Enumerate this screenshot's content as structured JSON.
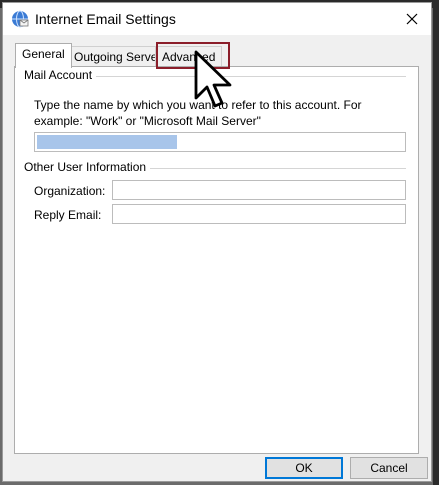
{
  "window": {
    "title": "Internet Email Settings",
    "title_icon": "globe-mail-icon",
    "close_icon": "close-icon"
  },
  "tabs": [
    {
      "label": "General",
      "active": true
    },
    {
      "label": "Outgoing Server",
      "active": false
    },
    {
      "label": "Advanced",
      "active": false
    }
  ],
  "mail_account": {
    "group_label": "Mail Account",
    "description": "Type the name by which you want to refer to this account. For example: \"Work\" or \"Microsoft Mail Server\"",
    "account_name_value": ""
  },
  "other_info": {
    "group_label": "Other User Information",
    "organization_label": "Organization:",
    "organization_value": "",
    "reply_email_label": "Reply Email:",
    "reply_email_value": ""
  },
  "footer": {
    "ok_label": "OK",
    "cancel_label": "Cancel"
  },
  "colors": {
    "highlight_box": "#8b1e2a",
    "selection": "#a8c5ea",
    "default_button_border": "#0078d7"
  }
}
